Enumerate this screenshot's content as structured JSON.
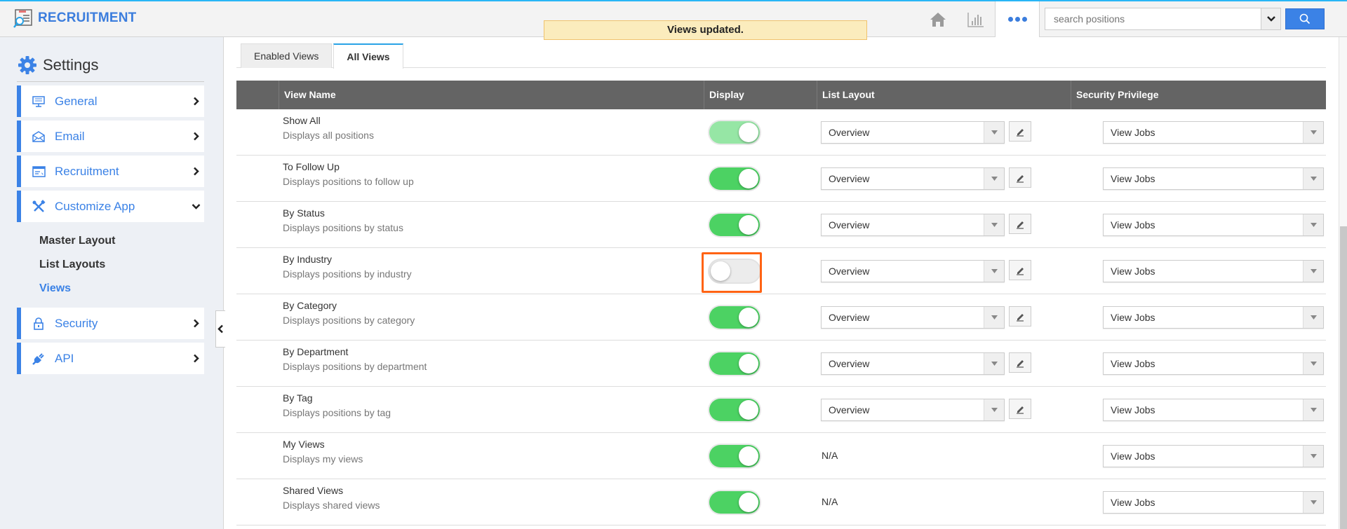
{
  "app": {
    "title": "RECRUITMENT",
    "brand_color": "#3b7ddd"
  },
  "header": {
    "icons": [
      "home-icon",
      "chart-icon",
      "more-icon"
    ],
    "search": {
      "placeholder": "search positions",
      "value": ""
    }
  },
  "toast": {
    "message": "Views updated."
  },
  "sidebar": {
    "title": "Settings",
    "items": [
      {
        "label": "General",
        "icon": "monitor-icon",
        "expanded": false
      },
      {
        "label": "Email",
        "icon": "envelope-icon",
        "expanded": false
      },
      {
        "label": "Recruitment",
        "icon": "window-icon",
        "expanded": false
      },
      {
        "label": "Customize App",
        "icon": "tools-icon",
        "expanded": true
      },
      {
        "label": "Security",
        "icon": "lock-icon",
        "expanded": false
      },
      {
        "label": "API",
        "icon": "plug-icon",
        "expanded": false
      }
    ],
    "subitems": [
      {
        "label": "Master Layout",
        "active": false
      },
      {
        "label": "List Layouts",
        "active": false
      },
      {
        "label": "Views",
        "active": true
      }
    ]
  },
  "tabs": [
    {
      "label": "Enabled Views",
      "active": false
    },
    {
      "label": "All Views",
      "active": true
    }
  ],
  "table": {
    "columns": [
      "View Name",
      "Display",
      "List Layout",
      "Security Privilege"
    ],
    "rows": [
      {
        "name": "Show All",
        "description": "Displays all positions",
        "display": true,
        "list_layout": "Overview",
        "security_privilege": "View Jobs"
      },
      {
        "name": "To Follow Up",
        "description": "Displays positions to follow up",
        "display": true,
        "list_layout": "Overview",
        "security_privilege": "View Jobs"
      },
      {
        "name": "By Status",
        "description": "Displays positions by status",
        "display": true,
        "list_layout": "Overview",
        "security_privilege": "View Jobs"
      },
      {
        "name": "By Industry",
        "description": "Displays positions by industry",
        "display": false,
        "list_layout": "Overview",
        "security_privilege": "View Jobs"
      },
      {
        "name": "By Category",
        "description": "Displays positions by category",
        "display": true,
        "list_layout": "Overview",
        "security_privilege": "View Jobs"
      },
      {
        "name": "By Department",
        "description": "Displays positions by department",
        "display": true,
        "list_layout": "Overview",
        "security_privilege": "View Jobs"
      },
      {
        "name": "By Tag",
        "description": "Displays positions by tag",
        "display": true,
        "list_layout": "Overview",
        "security_privilege": "View Jobs"
      },
      {
        "name": "My Views",
        "description": "Displays my views",
        "display": true,
        "list_layout": "N/A",
        "security_privilege": "View Jobs"
      },
      {
        "name": "Shared Views",
        "description": "Displays shared views",
        "display": true,
        "list_layout": "N/A",
        "security_privilege": "View Jobs"
      }
    ]
  },
  "colors": {
    "accent": "#3b82e6",
    "toggle_on": "#4cd263",
    "toggle_off": "#ececec",
    "highlight": "#ff6314",
    "toast_bg": "#fbecbd"
  }
}
